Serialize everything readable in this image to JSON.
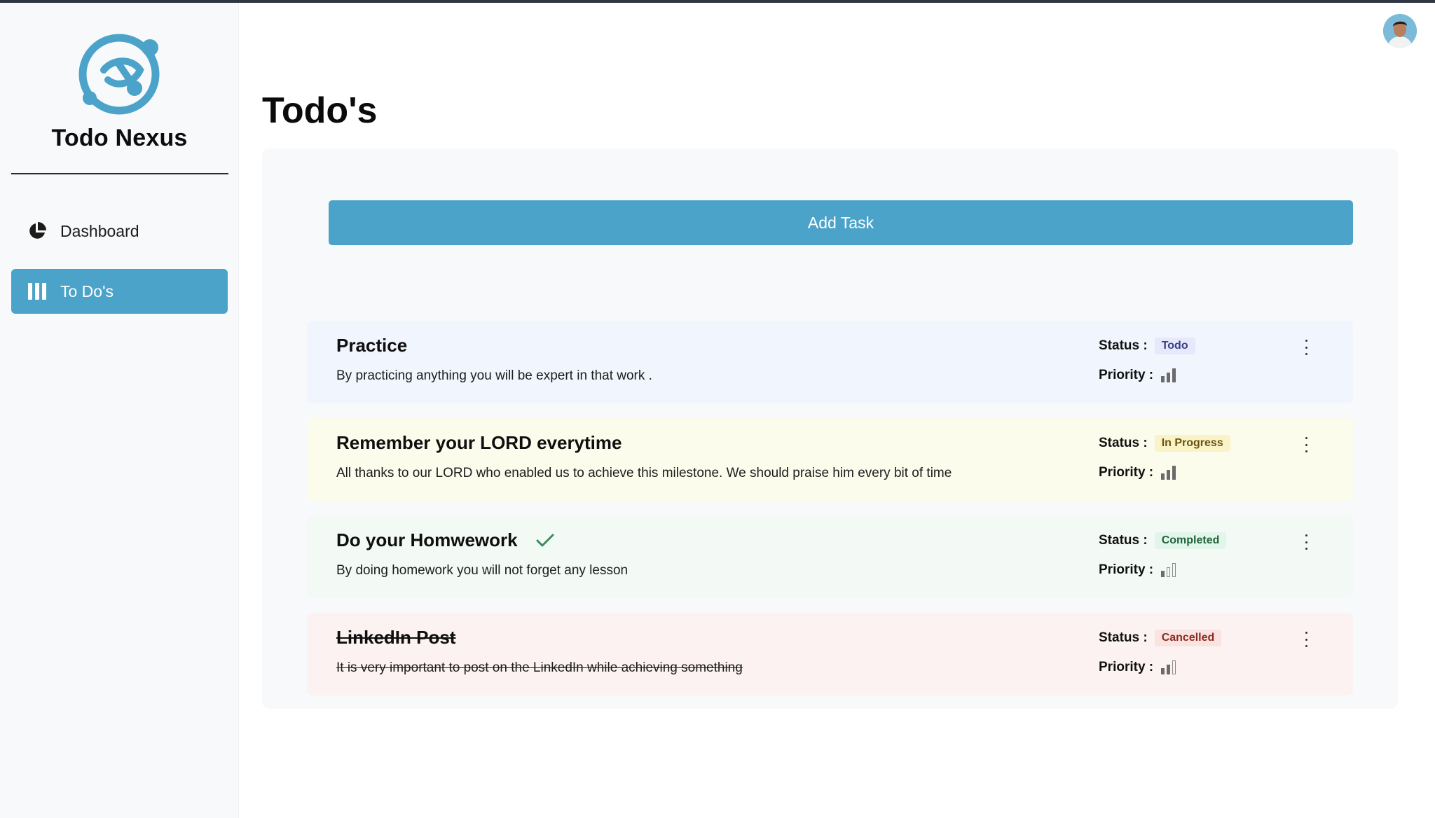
{
  "sidebar": {
    "brand": "Todo Nexus",
    "items": [
      {
        "label": "Dashboard",
        "icon": "pie-chart-icon",
        "active": false
      },
      {
        "label": "To Do's",
        "icon": "columns-icon",
        "active": true
      }
    ]
  },
  "main": {
    "title": "Todo's",
    "add_task_label": "Add Task",
    "status_label": "Status :",
    "priority_label": "Priority :",
    "tasks": [
      {
        "title": "Practice",
        "description": "By practicing anything you will be expert in that work .",
        "status": "Todo",
        "priority_level": 3,
        "completed": false,
        "struck": false
      },
      {
        "title": "Remember your LORD everytime",
        "description": "All thanks to our LORD who enabled us to achieve this milestone. We should praise him every bit of time",
        "status": "In Progress",
        "priority_level": 3,
        "completed": false,
        "struck": false
      },
      {
        "title": "Do your Homwework",
        "description": "By doing homework you will not forget any lesson",
        "status": "Completed",
        "priority_level": 1,
        "completed": true,
        "struck": false
      },
      {
        "title": "LinkedIn Post",
        "description": "It is very important to post on the LinkedIn while achieving something",
        "status": "Cancelled",
        "priority_level": 2,
        "completed": false,
        "struck": true
      }
    ]
  },
  "colors": {
    "accent": "#4ca3c9",
    "card_todo_bg": "#f1f5fe",
    "card_progress_bg": "#fbfcec",
    "card_completed_bg": "#f3faf6",
    "card_cancelled_bg": "#fbf2f1",
    "badge_todo": "#e5e9fb",
    "badge_progress": "#faf3c8",
    "badge_completed": "#e2f5ea",
    "badge_cancelled": "#f9e4e1"
  }
}
